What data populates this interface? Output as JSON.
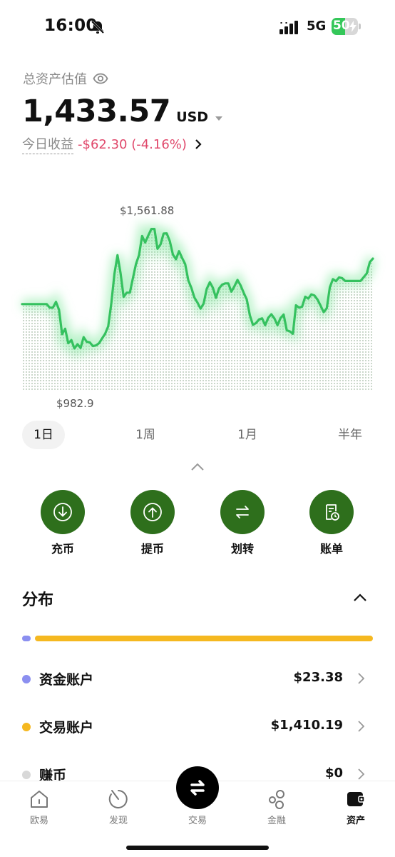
{
  "status_bar": {
    "time": "16:00",
    "network": "5G",
    "battery": "50",
    "battery_level": 0.5
  },
  "header": {
    "asset_label": "总资产估值",
    "balance": "1,433.57",
    "currency": "USD",
    "pnl_label": "今日收益",
    "pnl_value": "-$62.30 (-4.16%)"
  },
  "chart_data": {
    "type": "area",
    "y_unit": "USD",
    "high_label": "$1,561.88",
    "low_label": "$982.9",
    "ylim": [
      982.9,
      1561.88
    ],
    "values": [
      1216.4,
      1216.4,
      1216.4,
      1216.4,
      1216.4,
      1216.4,
      1216.4,
      1216.4,
      1216.4,
      1200.7,
      1200.7,
      1226.1,
      1191.3,
      1084.0,
      1107.7,
      1043.9,
      1057.7,
      1020.9,
      1039.9,
      1022.8,
      1070.7,
      1050.4,
      1047.7,
      1031.3,
      1034.2,
      1043.9,
      1064.9,
      1086.2,
      1118.9,
      1221.6,
      1349.4,
      1432.0,
      1352.2,
      1248.2,
      1266.7,
      1266.7,
      1330.2,
      1392.8,
      1432.0,
      1516.7,
      1487.5,
      1518.1,
      1547.4,
      1547.4,
      1459.9,
      1479.9,
      1527.2,
      1528.1,
      1493.2,
      1434.9,
      1413.9,
      1449.7,
      1419.5,
      1392.8,
      1321.0,
      1287.8,
      1245.0,
      1222.6,
      1196.1,
      1219.0,
      1282.7,
      1312.6,
      1288.2,
      1244.1,
      1285.3,
      1302.0,
      1307.7,
      1307.7,
      1271.0,
      1295.2,
      1322.6,
      1299.0,
      1266.7,
      1236.9,
      1167.6,
      1124.8,
      1132.7,
      1148.8,
      1153.5,
      1123.1,
      1156.2,
      1171.4,
      1153.1,
      1123.1,
      1154.9,
      1170.0,
      1101.0,
      1096.2,
      1085.9,
      1211.1,
      1200.9,
      1204.7,
      1248.9,
      1240.5,
      1259.2,
      1254.5,
      1236.3,
      1209.9,
      1180.9,
      1198.0,
      1290.4,
      1326.1,
      1317.4,
      1333.6,
      1331.0,
      1318.2,
      1318.2,
      1318.2,
      1318.2,
      1318.2,
      1318.2,
      1335.0,
      1351.3,
      1401.0,
      1416.8
    ]
  },
  "period_tabs": [
    "1日",
    "1周",
    "1月",
    "半年"
  ],
  "active_period": "1日",
  "actions": [
    {
      "label": "充币",
      "icon": "deposit-icon"
    },
    {
      "label": "提币",
      "icon": "withdraw-icon"
    },
    {
      "label": "划转",
      "icon": "transfer-icon"
    },
    {
      "label": "账单",
      "icon": "bill-icon"
    }
  ],
  "distribution": {
    "title": "分布",
    "accounts": [
      {
        "name": "资金账户",
        "value": "$23.38",
        "color": "#8b8ff0"
      },
      {
        "name": "交易账户",
        "value": "$1,410.19",
        "color": "#f5b820"
      },
      {
        "name": "赚币",
        "value": "$0",
        "color": "#d8d8d8"
      }
    ]
  },
  "colors": {
    "accent_green": "#2e6f1c",
    "chart_line": "#35c15f",
    "negative": "#e0486b"
  },
  "bottom_nav": [
    {
      "label": "欧易",
      "icon": "home-icon"
    },
    {
      "label": "发现",
      "icon": "discover-icon"
    },
    {
      "label": "交易",
      "icon": "trade-swap-icon"
    },
    {
      "label": "金融",
      "icon": "finance-icon"
    },
    {
      "label": "资产",
      "icon": "wallet-icon"
    }
  ],
  "active_nav": "资产"
}
